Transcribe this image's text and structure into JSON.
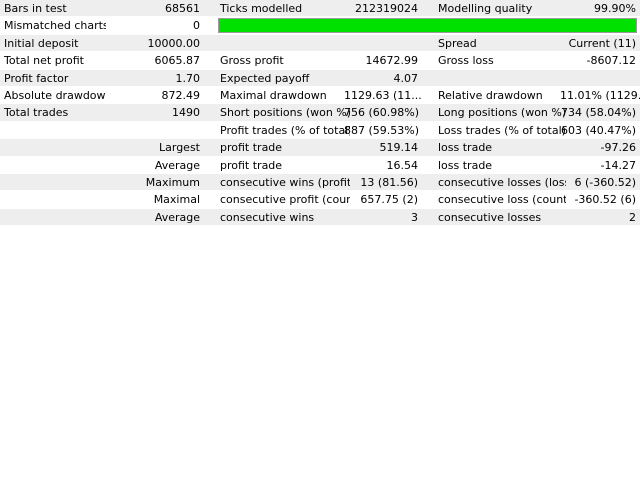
{
  "colors": {
    "row_shade": "#eeeeee",
    "quality_bar": "#00e100"
  },
  "report": {
    "row0": {
      "c1": "Bars in test",
      "v1": "68561",
      "c2": "Ticks modelled",
      "v2": "212319024",
      "c3": "Modelling quality",
      "v3": "99.90%"
    },
    "row1": {
      "c1": "Mismatched charts ...",
      "v1": "0",
      "quality_fraction": 0.999
    },
    "row2": {
      "c1": "Initial deposit",
      "v1": "10000.00",
      "c3": "Spread",
      "v3": "Current (11)"
    },
    "row3": {
      "c1": "Total net profit",
      "v1": "6065.87",
      "c2": "Gross profit",
      "v2": "14672.99",
      "c3": "Gross loss",
      "v3": "-8607.12"
    },
    "row4": {
      "c1": "Profit factor",
      "v1": "1.70",
      "c2": "Expected payoff",
      "v2": "4.07"
    },
    "row5": {
      "c1": "Absolute drawdown",
      "v1": "872.49",
      "c2": "Maximal drawdown",
      "v2": "1129.63 (11....",
      "c3": "Relative drawdown",
      "v3": "11.01% (1129...."
    },
    "row6": {
      "c1": "Total trades",
      "v1": "1490",
      "c2": "Short positions (won %)",
      "v2": "756 (60.98%)",
      "c3": "Long positions (won %)",
      "v3": "734 (58.04%)"
    },
    "row7": {
      "c2": "Profit trades (% of total)",
      "v2": "887 (59.53%)",
      "c3": "Loss trades (% of total)",
      "v3": "603 (40.47%)"
    },
    "row8": {
      "v1": "Largest",
      "c2": "profit trade",
      "v2": "519.14",
      "c3": "loss trade",
      "v3": "-97.26"
    },
    "row9": {
      "v1": "Average",
      "c2": "profit trade",
      "v2": "16.54",
      "c3": "loss trade",
      "v3": "-14.27"
    },
    "row10": {
      "v1": "Maximum",
      "c2": "consecutive wins (profit ...",
      "v2": "13 (81.56)",
      "c3": "consecutive losses (loss...",
      "v3": "6 (-360.52)"
    },
    "row11": {
      "v1": "Maximal",
      "c2": "consecutive profit (coun...",
      "v2": "657.75 (2)",
      "c3": "consecutive loss (count ...",
      "v3": "-360.52 (6)"
    },
    "row12": {
      "v1": "Average",
      "c2": "consecutive wins",
      "v2": "3",
      "c3": "consecutive losses",
      "v3": "2"
    }
  }
}
